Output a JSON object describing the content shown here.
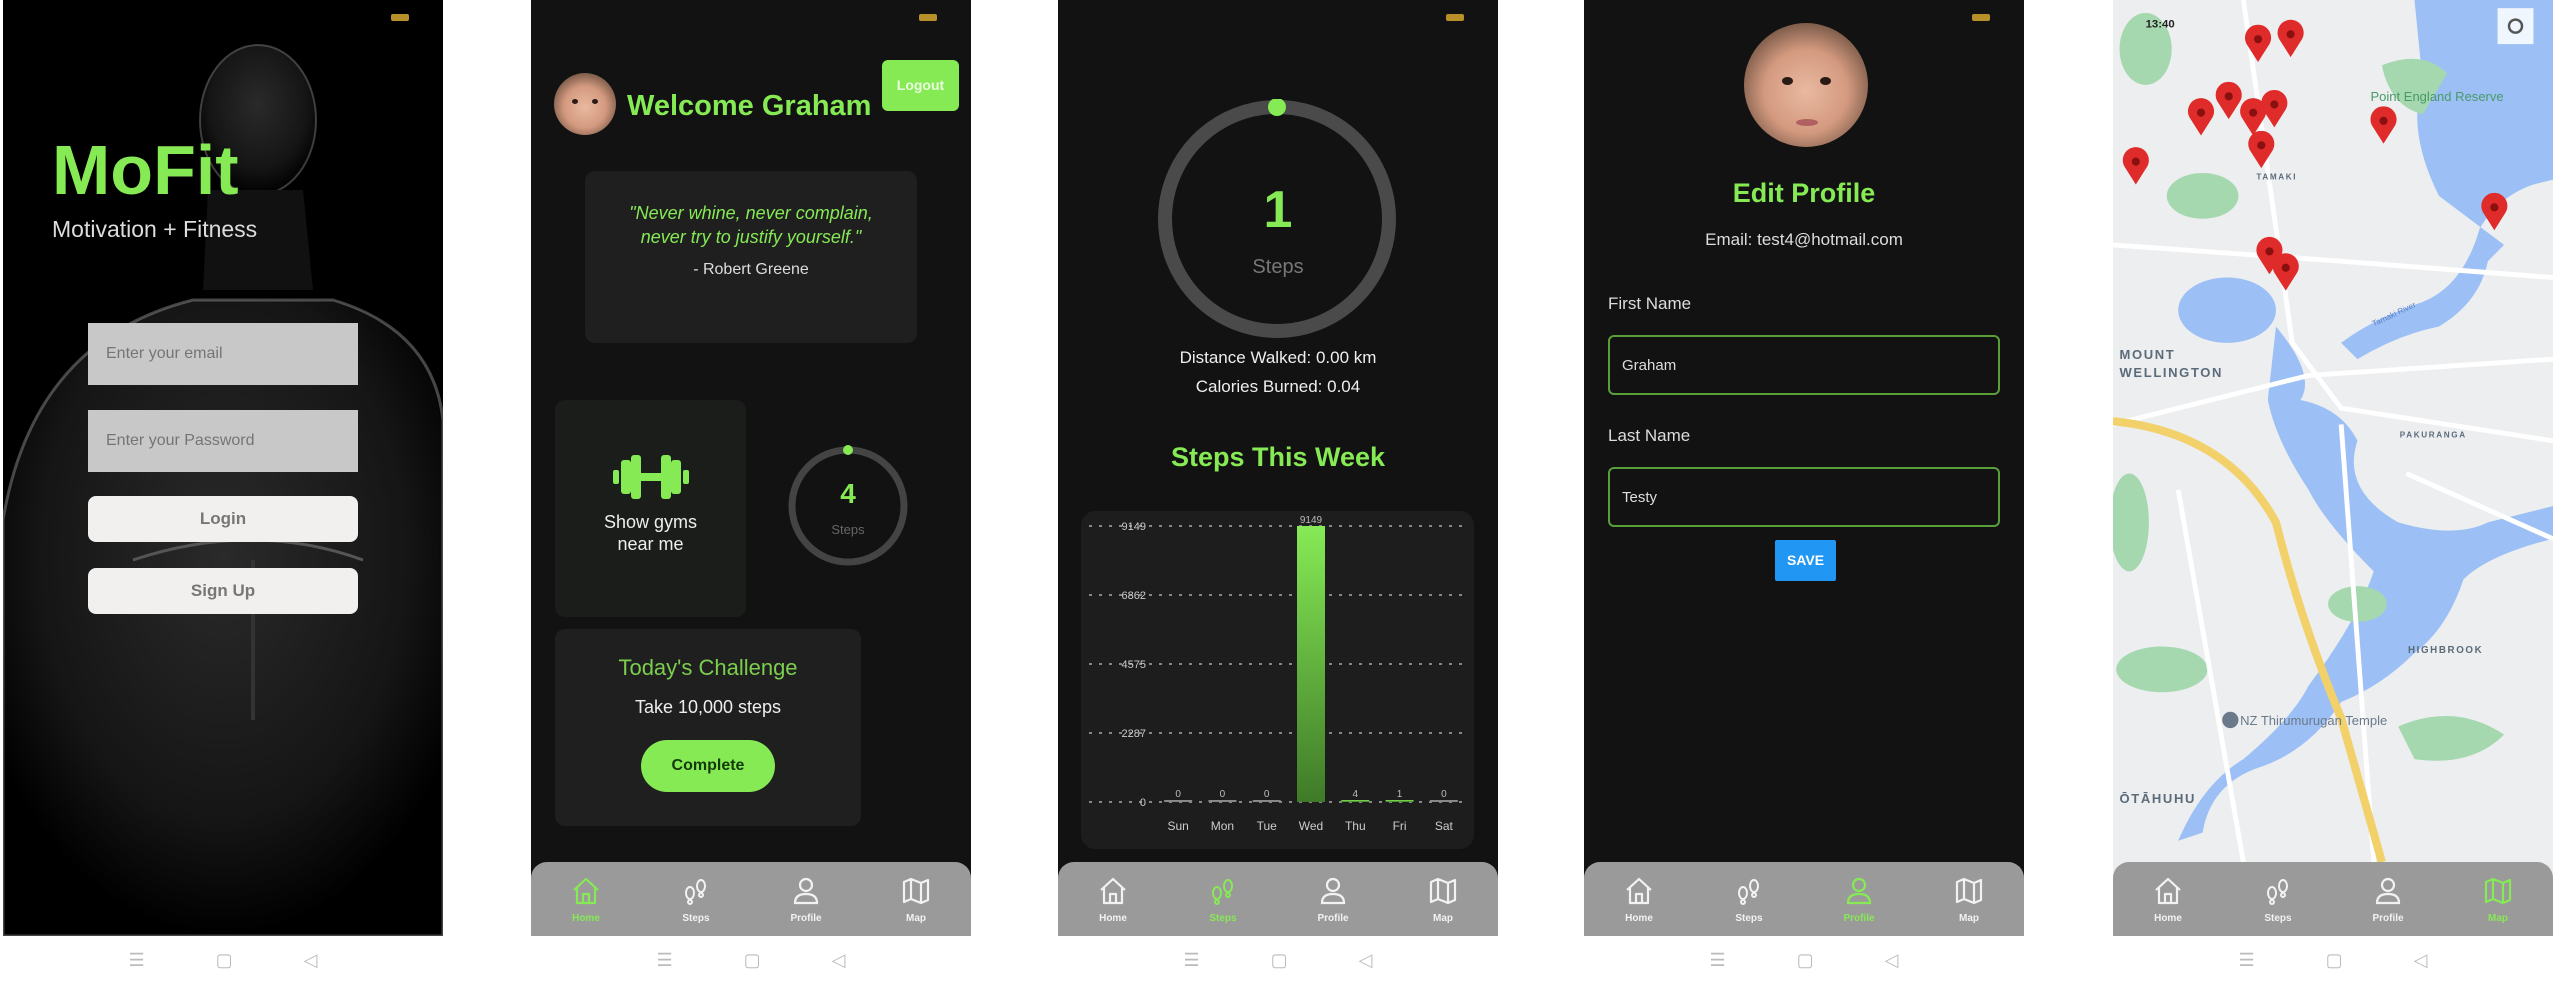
{
  "colors": {
    "accent": "#86ea55",
    "background": "#121212",
    "card": "#1f1f1f",
    "save_button": "#2196f3",
    "nav_bar": "#9a9a9a"
  },
  "nav": [
    {
      "label": "Home",
      "icon": "home-icon"
    },
    {
      "label": "Steps",
      "icon": "footsteps-icon"
    },
    {
      "label": "Profile",
      "icon": "person-icon"
    },
    {
      "label": "Map",
      "icon": "map-icon"
    }
  ],
  "login": {
    "title": "MoFit",
    "subtitle": "Motivation + Fitness",
    "email_placeholder": "Enter your email",
    "password_placeholder": "Enter your Password",
    "login_label": "Login",
    "signup_label": "Sign Up"
  },
  "home": {
    "welcome": "Welcome Graham",
    "logout_label": "Logout",
    "quote": "\"Never whine, never complain, never try to justify yourself.\"",
    "quote_author": "- Robert Greene",
    "gym_label": "Show gyms near me",
    "steps_value": "4",
    "steps_label": "Steps",
    "challenge_title": "Today's Challenge",
    "challenge_text": "Take 10,000 steps",
    "complete_label": "Complete",
    "active_nav": "Home"
  },
  "steps": {
    "value": "1",
    "label": "Steps",
    "distance": "Distance Walked: 0.00 km",
    "calories": "Calories Burned: 0.04",
    "week_title": "Steps This Week",
    "active_nav": "Steps"
  },
  "chart_data": {
    "type": "bar",
    "title": "Steps This Week",
    "categories": [
      "Sun",
      "Mon",
      "Tue",
      "Wed",
      "Thu",
      "Fri",
      "Sat"
    ],
    "values": [
      0,
      0,
      0,
      9149,
      4,
      1,
      0
    ],
    "yticks": [
      0,
      2287,
      4575,
      6862,
      9149
    ],
    "ylim": [
      0,
      9149
    ],
    "grid": true,
    "bar_color": "#86ea55"
  },
  "profile": {
    "title": "Edit Profile",
    "email": "Email: test4@hotmail.com",
    "first_name_label": "First Name",
    "first_name": "Graham",
    "last_name_label": "Last Name",
    "last_name": "Testy",
    "save_label": "SAVE",
    "active_nav": "Profile"
  },
  "map": {
    "time": "13:40",
    "labels": {
      "point_england": "Point England Reserve",
      "tamaki": "TAMAKI",
      "mount": "MOUNT",
      "wellington": "WELLINGTON",
      "pakuranga": "PAKURANGA",
      "highbrook": "HIGHBROOK",
      "temple": "NZ Thirumurugan Temple",
      "otahuhu": "ŌTĀHUHU",
      "river": "Tamaki River"
    },
    "pin_count": 12,
    "active_nav": "Map"
  }
}
